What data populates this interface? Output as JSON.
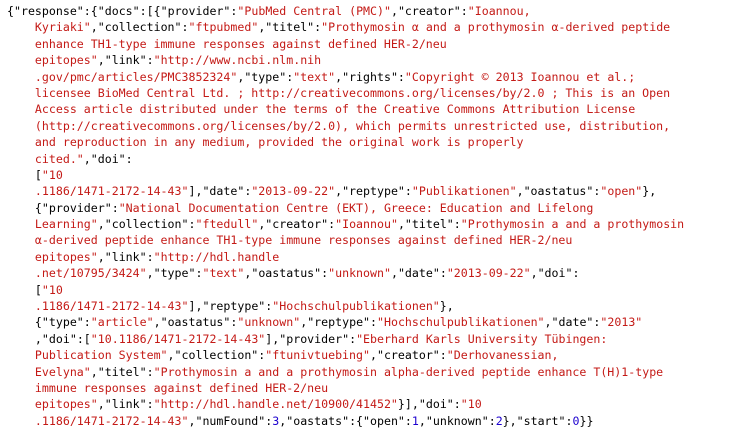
{
  "document": {
    "lines": [
      [
        [
          "p",
          "{"
        ],
        [
          "k",
          "\"response\""
        ],
        [
          "p",
          ":{"
        ],
        [
          "k",
          "\"docs\""
        ],
        [
          "p",
          ":[{"
        ],
        [
          "k",
          "\"provider\""
        ],
        [
          "p",
          ":"
        ],
        [
          "s",
          "\"PubMed Central (PMC)\""
        ],
        [
          "p",
          ","
        ],
        [
          "k",
          "\"creator\""
        ],
        [
          "p",
          ":"
        ],
        [
          "s",
          "\"Ioannou,"
        ]
      ],
      [
        [
          "s",
          "    Kyriaki\""
        ],
        [
          "p",
          ","
        ],
        [
          "k",
          "\"collection\""
        ],
        [
          "p",
          ":"
        ],
        [
          "s",
          "\"ftpubmed\""
        ],
        [
          "p",
          ","
        ],
        [
          "k",
          "\"titel\""
        ],
        [
          "p",
          ":"
        ],
        [
          "s",
          "\"Prothymosin α and a prothymosin α-derived peptide"
        ]
      ],
      [
        [
          "s",
          "    enhance TH1-type immune responses against defined HER-2/neu"
        ]
      ],
      [
        [
          "s",
          "    epitopes\""
        ],
        [
          "p",
          ","
        ],
        [
          "k",
          "\"link\""
        ],
        [
          "p",
          ":"
        ],
        [
          "s",
          "\"http://www.ncbi.nlm.nih"
        ]
      ],
      [
        [
          "s",
          "    .gov/pmc/articles/PMC3852324\""
        ],
        [
          "p",
          ","
        ],
        [
          "k",
          "\"type\""
        ],
        [
          "p",
          ":"
        ],
        [
          "s",
          "\"text\""
        ],
        [
          "p",
          ","
        ],
        [
          "k",
          "\"rights\""
        ],
        [
          "p",
          ":"
        ],
        [
          "s",
          "\"Copyright © 2013 Ioannou et al.;"
        ]
      ],
      [
        [
          "s",
          "    licensee BioMed Central Ltd. ; http://creativecommons.org/licenses/by/2.0 ; This is an Open"
        ]
      ],
      [
        [
          "s",
          "    Access article distributed under the terms of the Creative Commons Attribution License"
        ]
      ],
      [
        [
          "s",
          "    (http://creativecommons.org/licenses/by/2.0), which permits unrestricted use, distribution,"
        ]
      ],
      [
        [
          "s",
          "    and reproduction in any medium, provided the original work is properly"
        ]
      ],
      [
        [
          "s",
          "    cited.\""
        ],
        [
          "p",
          ","
        ],
        [
          "k",
          "\"doi\""
        ],
        [
          "p",
          ":"
        ]
      ],
      [
        [
          "p",
          "    ["
        ],
        [
          "s",
          "\"10"
        ]
      ],
      [
        [
          "s",
          "    .1186/1471-2172-14-43\""
        ],
        [
          "p",
          "],"
        ],
        [
          "k",
          "\"date\""
        ],
        [
          "p",
          ":"
        ],
        [
          "s",
          "\"2013-09-22\""
        ],
        [
          "p",
          ","
        ],
        [
          "k",
          "\"reptype\""
        ],
        [
          "p",
          ":"
        ],
        [
          "s",
          "\"Publikationen\""
        ],
        [
          "p",
          ","
        ],
        [
          "k",
          "\"oastatus\""
        ],
        [
          "p",
          ":"
        ],
        [
          "s",
          "\"open\""
        ],
        [
          "p",
          "},"
        ]
      ],
      [
        [
          "p",
          "    {"
        ],
        [
          "k",
          "\"provider\""
        ],
        [
          "p",
          ":"
        ],
        [
          "s",
          "\"National Documentation Centre (EKT), Greece: Education and Lifelong"
        ]
      ],
      [
        [
          "s",
          "    Learning\""
        ],
        [
          "p",
          ","
        ],
        [
          "k",
          "\"collection\""
        ],
        [
          "p",
          ":"
        ],
        [
          "s",
          "\"ftedull\""
        ],
        [
          "p",
          ","
        ],
        [
          "k",
          "\"creator\""
        ],
        [
          "p",
          ":"
        ],
        [
          "s",
          "\"Ioannou\""
        ],
        [
          "p",
          ","
        ],
        [
          "k",
          "\"titel\""
        ],
        [
          "p",
          ":"
        ],
        [
          "s",
          "\"Prothymosin a and a prothymosin"
        ]
      ],
      [
        [
          "s",
          "    α-derived peptide enhance TH1-type immune responses against defined HER-2/neu"
        ]
      ],
      [
        [
          "s",
          "    epitopes\""
        ],
        [
          "p",
          ","
        ],
        [
          "k",
          "\"link\""
        ],
        [
          "p",
          ":"
        ],
        [
          "s",
          "\"http://hdl.handle"
        ]
      ],
      [
        [
          "s",
          "    .net/10795/3424\""
        ],
        [
          "p",
          ","
        ],
        [
          "k",
          "\"type\""
        ],
        [
          "p",
          ":"
        ],
        [
          "s",
          "\"text\""
        ],
        [
          "p",
          ","
        ],
        [
          "k",
          "\"oastatus\""
        ],
        [
          "p",
          ":"
        ],
        [
          "s",
          "\"unknown\""
        ],
        [
          "p",
          ","
        ],
        [
          "k",
          "\"date\""
        ],
        [
          "p",
          ":"
        ],
        [
          "s",
          "\"2013-09-22\""
        ],
        [
          "p",
          ","
        ],
        [
          "k",
          "\"doi\""
        ],
        [
          "p",
          ":"
        ]
      ],
      [
        [
          "p",
          "    ["
        ],
        [
          "s",
          "\"10"
        ]
      ],
      [
        [
          "s",
          "    .1186/1471-2172-14-43\""
        ],
        [
          "p",
          "],"
        ],
        [
          "k",
          "\"reptype\""
        ],
        [
          "p",
          ":"
        ],
        [
          "s",
          "\"Hochschulpublikationen\""
        ],
        [
          "p",
          "},"
        ]
      ],
      [
        [
          "p",
          "    {"
        ],
        [
          "k",
          "\"type\""
        ],
        [
          "p",
          ":"
        ],
        [
          "s",
          "\"article\""
        ],
        [
          "p",
          ","
        ],
        [
          "k",
          "\"oastatus\""
        ],
        [
          "p",
          ":"
        ],
        [
          "s",
          "\"unknown\""
        ],
        [
          "p",
          ","
        ],
        [
          "k",
          "\"reptype\""
        ],
        [
          "p",
          ":"
        ],
        [
          "s",
          "\"Hochschulpublikationen\""
        ],
        [
          "p",
          ","
        ],
        [
          "k",
          "\"date\""
        ],
        [
          "p",
          ":"
        ],
        [
          "s",
          "\"2013\""
        ]
      ],
      [
        [
          "p",
          "    ,"
        ],
        [
          "k",
          "\"doi\""
        ],
        [
          "p",
          ":["
        ],
        [
          "s",
          "\"10.1186/1471-2172-14-43\""
        ],
        [
          "p",
          "],"
        ],
        [
          "k",
          "\"provider\""
        ],
        [
          "p",
          ":"
        ],
        [
          "s",
          "\"Eberhard Karls University Tübingen:"
        ]
      ],
      [
        [
          "s",
          "    Publication System\""
        ],
        [
          "p",
          ","
        ],
        [
          "k",
          "\"collection\""
        ],
        [
          "p",
          ":"
        ],
        [
          "s",
          "\"ftunivtuebing\""
        ],
        [
          "p",
          ","
        ],
        [
          "k",
          "\"creator\""
        ],
        [
          "p",
          ":"
        ],
        [
          "s",
          "\"Derhovanessian,"
        ]
      ],
      [
        [
          "s",
          "    Evelyna\""
        ],
        [
          "p",
          ","
        ],
        [
          "k",
          "\"titel\""
        ],
        [
          "p",
          ":"
        ],
        [
          "s",
          "\"Prothymosin a and a prothymosin alpha-derived peptide enhance T(H)1-type"
        ]
      ],
      [
        [
          "s",
          "    immune responses against defined HER-2/neu"
        ]
      ],
      [
        [
          "s",
          "    epitopes\""
        ],
        [
          "p",
          ","
        ],
        [
          "k",
          "\"link\""
        ],
        [
          "p",
          ":"
        ],
        [
          "s",
          "\"http://hdl.handle.net/10900/41452\""
        ],
        [
          "p",
          "}],"
        ],
        [
          "k",
          "\"doi\""
        ],
        [
          "p",
          ":"
        ],
        [
          "s",
          "\"10"
        ]
      ],
      [
        [
          "s",
          "    .1186/1471-2172-14-43\""
        ],
        [
          "p",
          ","
        ],
        [
          "k",
          "\"numFound\""
        ],
        [
          "p",
          ":"
        ],
        [
          "n",
          "3"
        ],
        [
          "p",
          ","
        ],
        [
          "k",
          "\"oastats\""
        ],
        [
          "p",
          ":{"
        ],
        [
          "k",
          "\"open\""
        ],
        [
          "p",
          ":"
        ],
        [
          "n",
          "1"
        ],
        [
          "p",
          ","
        ],
        [
          "k",
          "\"unknown\""
        ],
        [
          "p",
          ":"
        ],
        [
          "n",
          "2"
        ],
        [
          "p",
          "},"
        ],
        [
          "k",
          "\"start\""
        ],
        [
          "p",
          ":"
        ],
        [
          "n",
          "0"
        ],
        [
          "p",
          "}}"
        ]
      ]
    ]
  },
  "colors": {
    "key": "#000000",
    "string": "#c41a16",
    "number": "#1c00cf",
    "punctuation": "#000000",
    "background": "#ffffff"
  }
}
